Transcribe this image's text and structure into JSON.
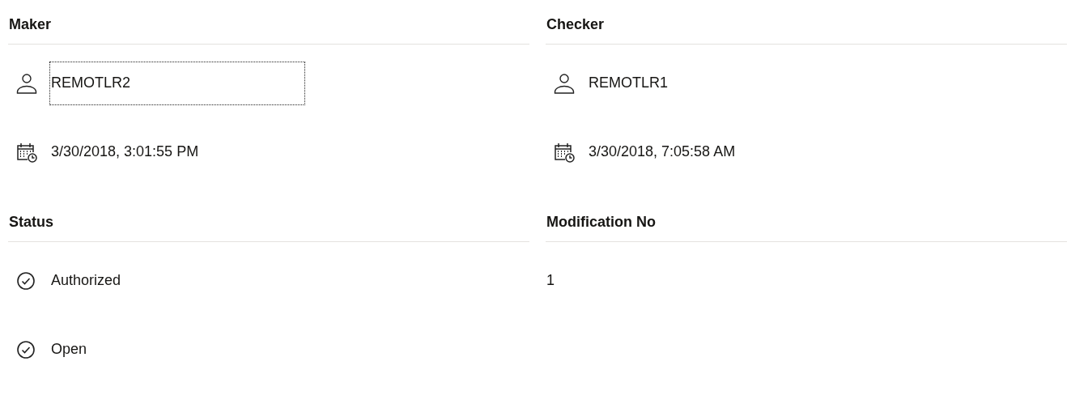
{
  "panels": [
    {
      "title": "Maker",
      "items": [
        {
          "kind": "user",
          "text": "REMOTLR2",
          "focused": true
        },
        {
          "kind": "calendar",
          "text": "3/30/2018, 3:01:55 PM",
          "focused": false
        }
      ]
    },
    {
      "title": "Checker",
      "items": [
        {
          "kind": "user",
          "text": "REMOTLR1",
          "focused": false
        },
        {
          "kind": "calendar",
          "text": "3/30/2018, 7:05:58 AM",
          "focused": false
        }
      ]
    },
    {
      "title": "Status",
      "items": [
        {
          "kind": "check",
          "text": "Authorized",
          "focused": false
        },
        {
          "kind": "check",
          "text": "Open",
          "focused": false
        }
      ]
    },
    {
      "title": "Modification No",
      "items": [
        {
          "kind": "plain",
          "text": "1",
          "focused": false
        }
      ]
    }
  ]
}
